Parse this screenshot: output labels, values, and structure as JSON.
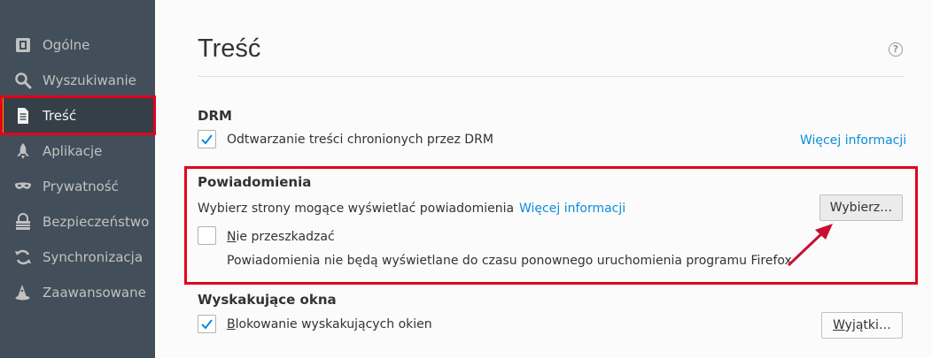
{
  "sidebar": {
    "items": [
      {
        "label": "Ogólne",
        "icon": "general-icon"
      },
      {
        "label": "Wyszukiwanie",
        "icon": "search-icon"
      },
      {
        "label": "Treść",
        "icon": "document-icon"
      },
      {
        "label": "Aplikacje",
        "icon": "rocket-icon"
      },
      {
        "label": "Prywatność",
        "icon": "mask-icon"
      },
      {
        "label": "Bezpieczeństwo",
        "icon": "lock-icon"
      },
      {
        "label": "Synchronizacja",
        "icon": "sync-icon"
      },
      {
        "label": "Zaawansowane",
        "icon": "wizard-hat-icon"
      }
    ],
    "selected": "Treść"
  },
  "page": {
    "title": "Treść",
    "help_symbol": "?"
  },
  "drm": {
    "heading": "DRM",
    "checkbox_label": "Odtwarzanie treści chronionych przez DRM",
    "checked": true,
    "more_info": "Więcej informacji"
  },
  "notifications": {
    "heading": "Powiadomienia",
    "description": "Wybierz strony mogące wyświetlać powiadomienia",
    "more_info": "Więcej informacji",
    "choose_button": "Wybierz…",
    "dnd_label_first": "N",
    "dnd_label_rest": "ie przeszkadzać",
    "dnd_checked": false,
    "dnd_note": "Powiadomienia nie będą wyświetlane do czasu ponownego uruchomienia programu Firefox"
  },
  "popups": {
    "heading": "Wyskakujące okna",
    "checkbox_label_first": "B",
    "checkbox_label_rest": "lokowanie wyskakujących okien",
    "checked": true,
    "exceptions_button_first": "W",
    "exceptions_button_rest": "yjątki…"
  },
  "colors": {
    "accent": "#0a8dda",
    "highlight": "#e3001b",
    "sidebar_bg": "#424f5a",
    "selected_marker": "#ff9500"
  }
}
